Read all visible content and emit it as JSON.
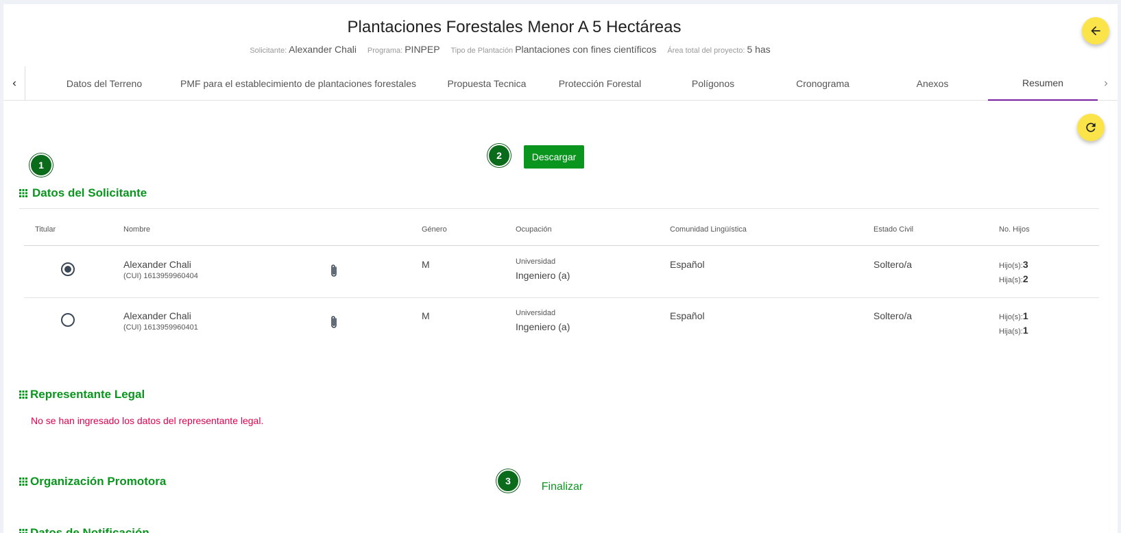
{
  "header": {
    "title": "Plantaciones Forestales Menor A 5 Hectáreas",
    "meta": [
      {
        "label": "Solicitante:",
        "value": "Alexander Chali"
      },
      {
        "label": "Programa:",
        "value": "PINPEP"
      },
      {
        "label": "Tipo de Plantación",
        "value": "Plantaciones con fines científicos"
      },
      {
        "label": "Área total del proyecto:",
        "value": "5 has"
      }
    ]
  },
  "tabs": [
    {
      "label": "Datos del Terreno"
    },
    {
      "label": "PMF para el establecimiento de plantaciones forestales"
    },
    {
      "label": "Propuesta Tecnica"
    },
    {
      "label": "Protección Forestal"
    },
    {
      "label": "Polígonos"
    },
    {
      "label": "Cronograma"
    },
    {
      "label": "Anexos"
    },
    {
      "label": "Resumen",
      "active": true
    }
  ],
  "steps": [
    "1",
    "2",
    "3"
  ],
  "actions": {
    "download": "Descargar",
    "finish": "Finalizar"
  },
  "sections": {
    "solicitante": "Datos del Solicitante",
    "representante": "Representante Legal",
    "organizacion": "Organización Promotora",
    "notificacion": "Datos de Notificación"
  },
  "representante_empty": "No se han ingresado los datos del representante legal.",
  "table": {
    "headers": [
      "Titular",
      "Nombre",
      "Género",
      "Ocupación",
      "Comunidad Lingüística",
      "Estado Civil",
      "No. Hijos"
    ],
    "rows": [
      {
        "titular": true,
        "name": "Alexander Chali",
        "cui": "(CUI) 1613959960404",
        "genero": "M",
        "ocupacion_nivel": "Universidad",
        "ocupacion": "Ingeniero (a)",
        "comunidad": "Español",
        "estado_civil": "Soltero/a",
        "hijos_label": "Hijo(s):",
        "hijos": "3",
        "hijas_label": "Hija(s):",
        "hijas": "2"
      },
      {
        "titular": false,
        "name": "Alexander Chali",
        "cui": "(CUI) 1613959960401",
        "genero": "M",
        "ocupacion_nivel": "Universidad",
        "ocupacion": "Ingeniero (a)",
        "comunidad": "Español",
        "estado_civil": "Soltero/a",
        "hijos_label": "Hijo(s):",
        "hijos": "1",
        "hijas_label": "Hija(s):",
        "hijas": "1"
      }
    ]
  },
  "colors": {
    "accent_green": "#0a951f",
    "step_green": "#0a6b1a",
    "fab_yellow": "#fbe44a",
    "tab_active": "#7b1fa2",
    "error": "#e0004d"
  },
  "icons": {
    "back": "arrow-left-icon",
    "refresh": "refresh-icon",
    "attachment": "paperclip-icon",
    "section": "grid-icon"
  }
}
